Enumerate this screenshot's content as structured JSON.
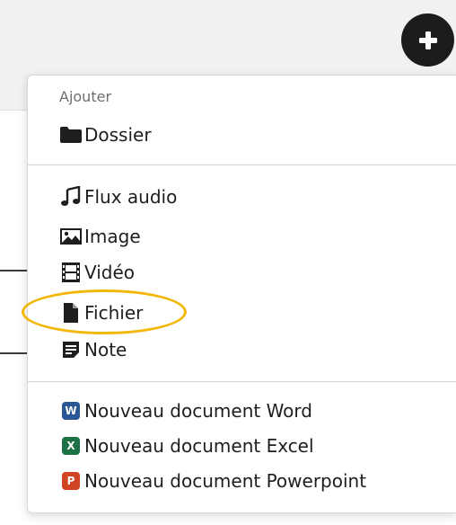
{
  "header": {
    "add_button_icon": "plus-icon"
  },
  "menu": {
    "section_label": "Ajouter",
    "folder": {
      "label": "Dossier",
      "icon": "folder-icon"
    },
    "media_items": [
      {
        "label": "Flux audio",
        "icon": "music-note-icon"
      },
      {
        "label": "Image",
        "icon": "image-icon"
      },
      {
        "label": "Vidéo",
        "icon": "film-icon"
      },
      {
        "label": "Fichier",
        "icon": "file-icon"
      },
      {
        "label": "Note",
        "icon": "note-icon"
      }
    ],
    "office_items": [
      {
        "label": "Nouveau document Word",
        "badge": "W",
        "color": "#2b5797"
      },
      {
        "label": "Nouveau document Excel",
        "badge": "X",
        "color": "#1e7145"
      },
      {
        "label": "Nouveau document Powerpoint",
        "badge": "P",
        "color": "#d04423"
      }
    ]
  },
  "colors": {
    "highlight_ring": "#f2b705",
    "add_button": "#1c1c1c"
  }
}
